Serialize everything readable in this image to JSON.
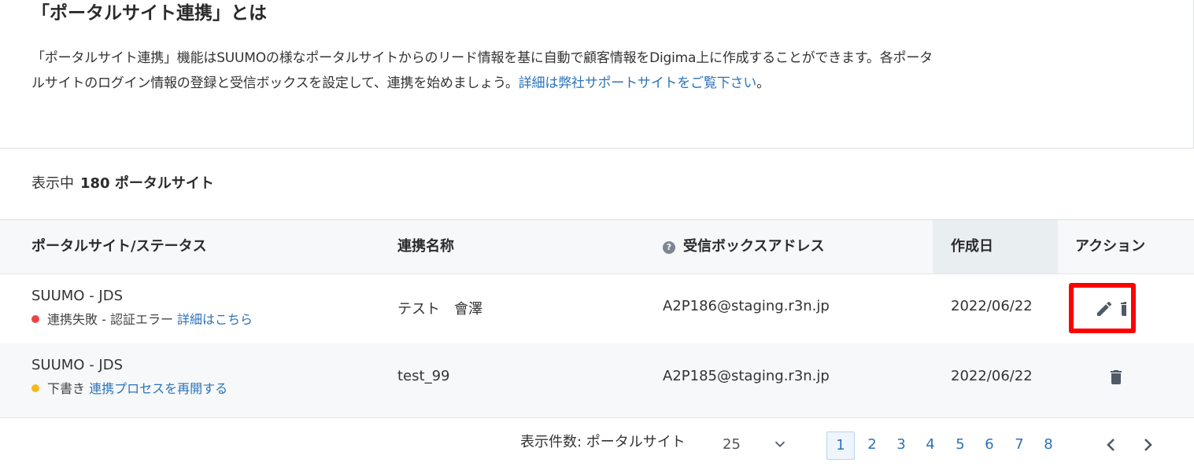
{
  "info": {
    "title": "「ポータルサイト連携」とは",
    "description_line1": "「ポータルサイト連携」機能はSUUMOの様なポータルサイトからのリード情報を基に自動で顧客情報をDigima上に作成することができます。各ポータ",
    "description_line2": "ルサイトのログイン情報の登録と受信ボックスを設定して、連携を始めましょう。",
    "support_link": "詳細は弊社サポートサイトをご覧下さい",
    "period": "。"
  },
  "count": {
    "prefix": "表示中",
    "value": "180 ポータルサイト"
  },
  "table": {
    "headers": {
      "site_status": "ポータルサイト/ステータス",
      "name": "連携名称",
      "inbox": "受信ボックスアドレス",
      "created": "作成日",
      "actions": "アクション"
    },
    "rows": [
      {
        "site": "SUUMO - JDS",
        "status": "連携失敗 - 認証エラー",
        "status_color": "#e8444a",
        "status_link": "詳細はこちら",
        "name": "テスト　會澤",
        "inbox": "A2P186@staging.r3n.jp",
        "created": "2022/06/22"
      },
      {
        "site": "SUUMO - JDS",
        "status": "下書き",
        "status_color": "#f5b91d",
        "status_link": "連携プロセスを再開する",
        "name": "test_99",
        "inbox": "A2P185@staging.r3n.jp",
        "created": "2022/06/22"
      }
    ]
  },
  "pager": {
    "label": "表示件数: ポータルサイト",
    "size": "25",
    "pages": [
      "1",
      "2",
      "3",
      "4",
      "5",
      "6",
      "7",
      "8"
    ],
    "active_page": "1"
  },
  "icons": {
    "edit": "pencil-icon",
    "delete": "trash-icon",
    "help": "question-circle-icon",
    "dropdown": "chevron-down-icon",
    "prev": "chevron-left-icon",
    "next": "chevron-right-icon"
  },
  "colors": {
    "link": "#2b73b9",
    "highlight": "#ff0000",
    "icon": "#505a66"
  }
}
